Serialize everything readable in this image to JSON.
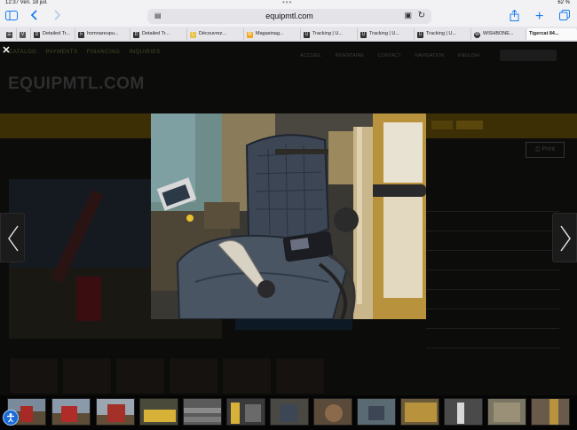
{
  "status": {
    "time": "12:37  Ven. 18 juil.",
    "battery": "62 %"
  },
  "browser": {
    "url": "equipmtl.com",
    "tabs": [
      {
        "label": "",
        "icon": "V"
      },
      {
        "label": "Detailed Tr...",
        "icon": "D"
      },
      {
        "label": "homnareupu...",
        "icon": "h"
      },
      {
        "label": "Detailed Tr...",
        "icon": "D"
      },
      {
        "label": "Découvrez...",
        "icon": "L"
      },
      {
        "label": "Magasinag...",
        "icon": "M"
      },
      {
        "label": "Tracking | U...",
        "icon": "U"
      },
      {
        "label": "Tracking | U...",
        "icon": "U"
      },
      {
        "label": "Tracking | U...",
        "icon": "U"
      },
      {
        "label": "WISHBONE...",
        "icon": "W"
      },
      {
        "label": "Tigercat 84...",
        "icon": "T"
      }
    ]
  },
  "site": {
    "logo": "EQUIPMTL.COM",
    "nav_left": [
      "CATALOG",
      "PAYMENTS",
      "FINANCING",
      "INQUIRIES"
    ],
    "nav_right": [
      "ACCUEIL",
      "INVENTAIRE",
      "CONTACT",
      "NAVIGATION",
      "ENGLISH"
    ],
    "print_label": "Print"
  },
  "lightbox": {
    "close_icon": "close-icon",
    "prev_icon": "chevron-left-icon",
    "next_icon": "chevron-right-icon",
    "thumbnail_count": 13
  }
}
